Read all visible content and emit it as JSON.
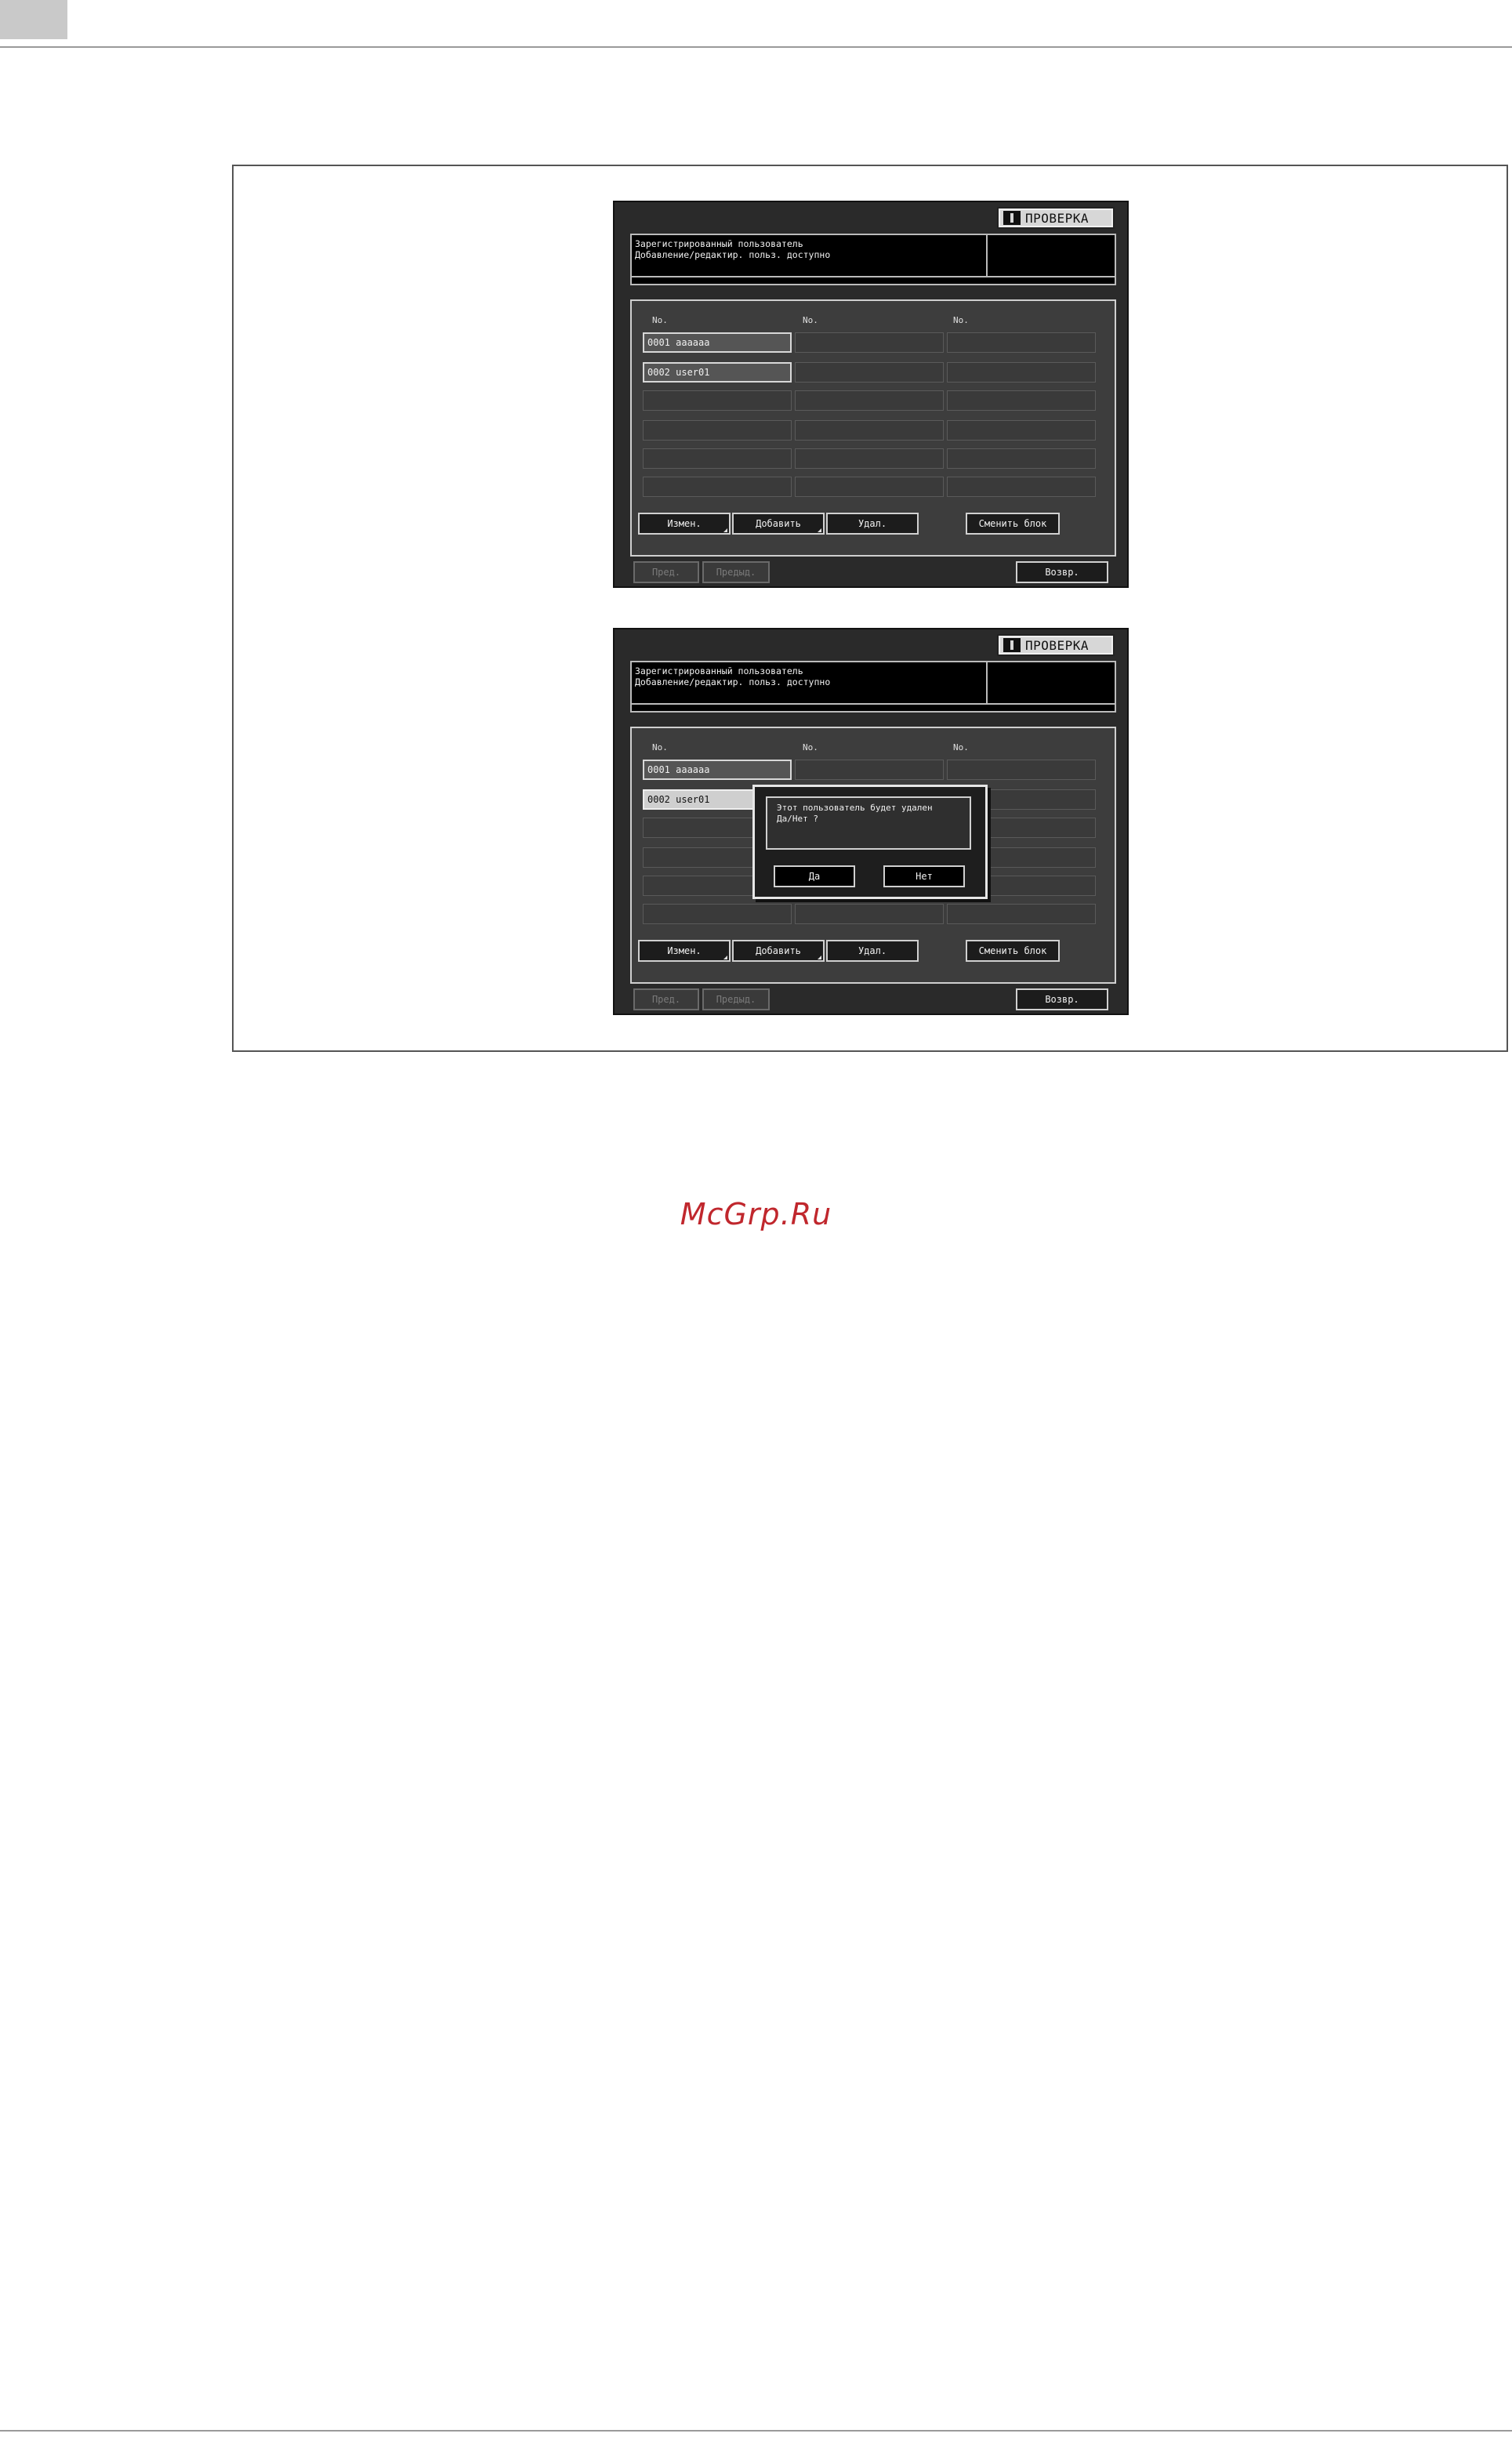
{
  "watermark": "McGrp.Ru",
  "screen": {
    "check_label": "ПРОВЕРКА",
    "message_line1": "Зарегистрированный пользователь",
    "message_line2": "Добавление/редактир. польз. доступно",
    "column_header": "No.",
    "users": [
      "0001 aaaaaa",
      "0002 user01"
    ],
    "buttons": {
      "edit": "Измен.",
      "add": "Добавить",
      "delete": "Удал.",
      "change_block": "Сменить блок",
      "prev": "Пред.",
      "next": "Предыд.",
      "back": "Возвр."
    }
  },
  "dialog": {
    "message_line1": "Этот пользователь будет удален",
    "message_line2": "Да/Нет ?",
    "yes": "Да",
    "no": "Нет"
  },
  "colors": {
    "watermark": "#c0272d",
    "screen_bg": "#2a2a2a",
    "panel_bg": "#3d3d3d"
  }
}
